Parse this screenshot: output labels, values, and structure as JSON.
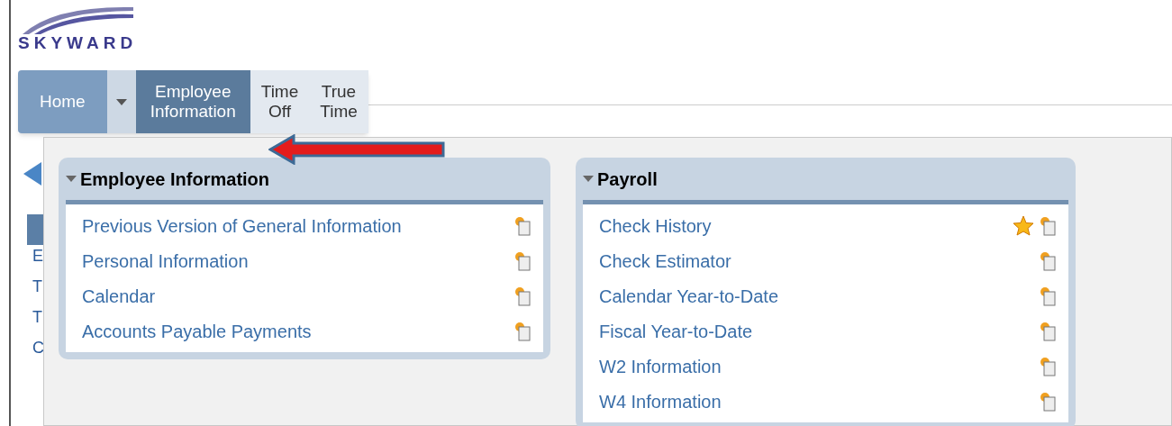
{
  "logo": {
    "text": "SKYWARD"
  },
  "tabs": [
    {
      "kind": "home",
      "label": "Home",
      "selected": false
    },
    {
      "kind": "module",
      "label": "Employee Information",
      "selected": true
    },
    {
      "kind": "module",
      "label": "Time Off",
      "selected": false
    },
    {
      "kind": "module",
      "label": "True Time",
      "selected": false
    }
  ],
  "background_fragments": [
    "E",
    "T",
    "T",
    "C"
  ],
  "panels": [
    {
      "title": "Employee Information",
      "items": [
        {
          "label": "Previous Version of General Information",
          "favorite": false
        },
        {
          "label": "Personal Information",
          "favorite": false
        },
        {
          "label": "Calendar",
          "favorite": false
        },
        {
          "label": "Accounts Payable Payments",
          "favorite": false
        }
      ]
    },
    {
      "title": "Payroll",
      "items": [
        {
          "label": "Check History",
          "favorite": true
        },
        {
          "label": "Check Estimator",
          "favorite": false
        },
        {
          "label": "Calendar Year-to-Date",
          "favorite": false
        },
        {
          "label": "Fiscal Year-to-Date",
          "favorite": false
        },
        {
          "label": "W2 Information",
          "favorite": false
        },
        {
          "label": "W4 Information",
          "favorite": false
        }
      ]
    }
  ]
}
